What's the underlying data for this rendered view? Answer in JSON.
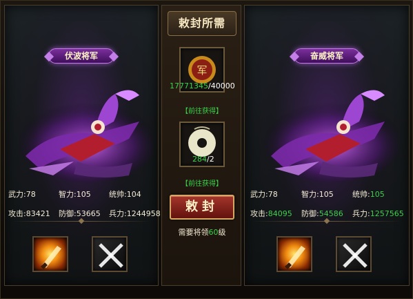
{
  "center": {
    "title": "敕封所需",
    "item1": {
      "name": "军",
      "have": "17771345",
      "need": "/40000",
      "link": "【前往获得】"
    },
    "item2": {
      "have": "284",
      "need": "/2",
      "link": "【前往获得】"
    },
    "seal_button": "敕封",
    "require_prefix": "需要将领",
    "require_level": "60",
    "require_suffix": "级"
  },
  "left": {
    "name": "伏波将军",
    "wuli": "武力:78",
    "zhili": "智力:105",
    "tongshuai": "统帅:104",
    "gongji": "攻击:83421",
    "fangyu": "防御:53665",
    "bingli": "兵力:1244958"
  },
  "right": {
    "name": "奋威将军",
    "wuli": "武力:78",
    "zhili_label": "智力:",
    "zhili": "105",
    "tongshuai_label": "统帅:",
    "tongshuai": "105",
    "gongji_label": "攻击:",
    "gongji": "84095",
    "fangyu_label": "防御:",
    "fangyu": "54586",
    "bingli_label": "兵力:",
    "bingli": "1257565"
  },
  "colors": {
    "green": "#3bd24a",
    "purple": "#c47ee8",
    "seal_red": "#a4352b"
  },
  "icons": [
    "military-seal-icon",
    "jade-disc-icon",
    "fire-sword-skill-icon",
    "crossed-swords-skill-icon"
  ]
}
